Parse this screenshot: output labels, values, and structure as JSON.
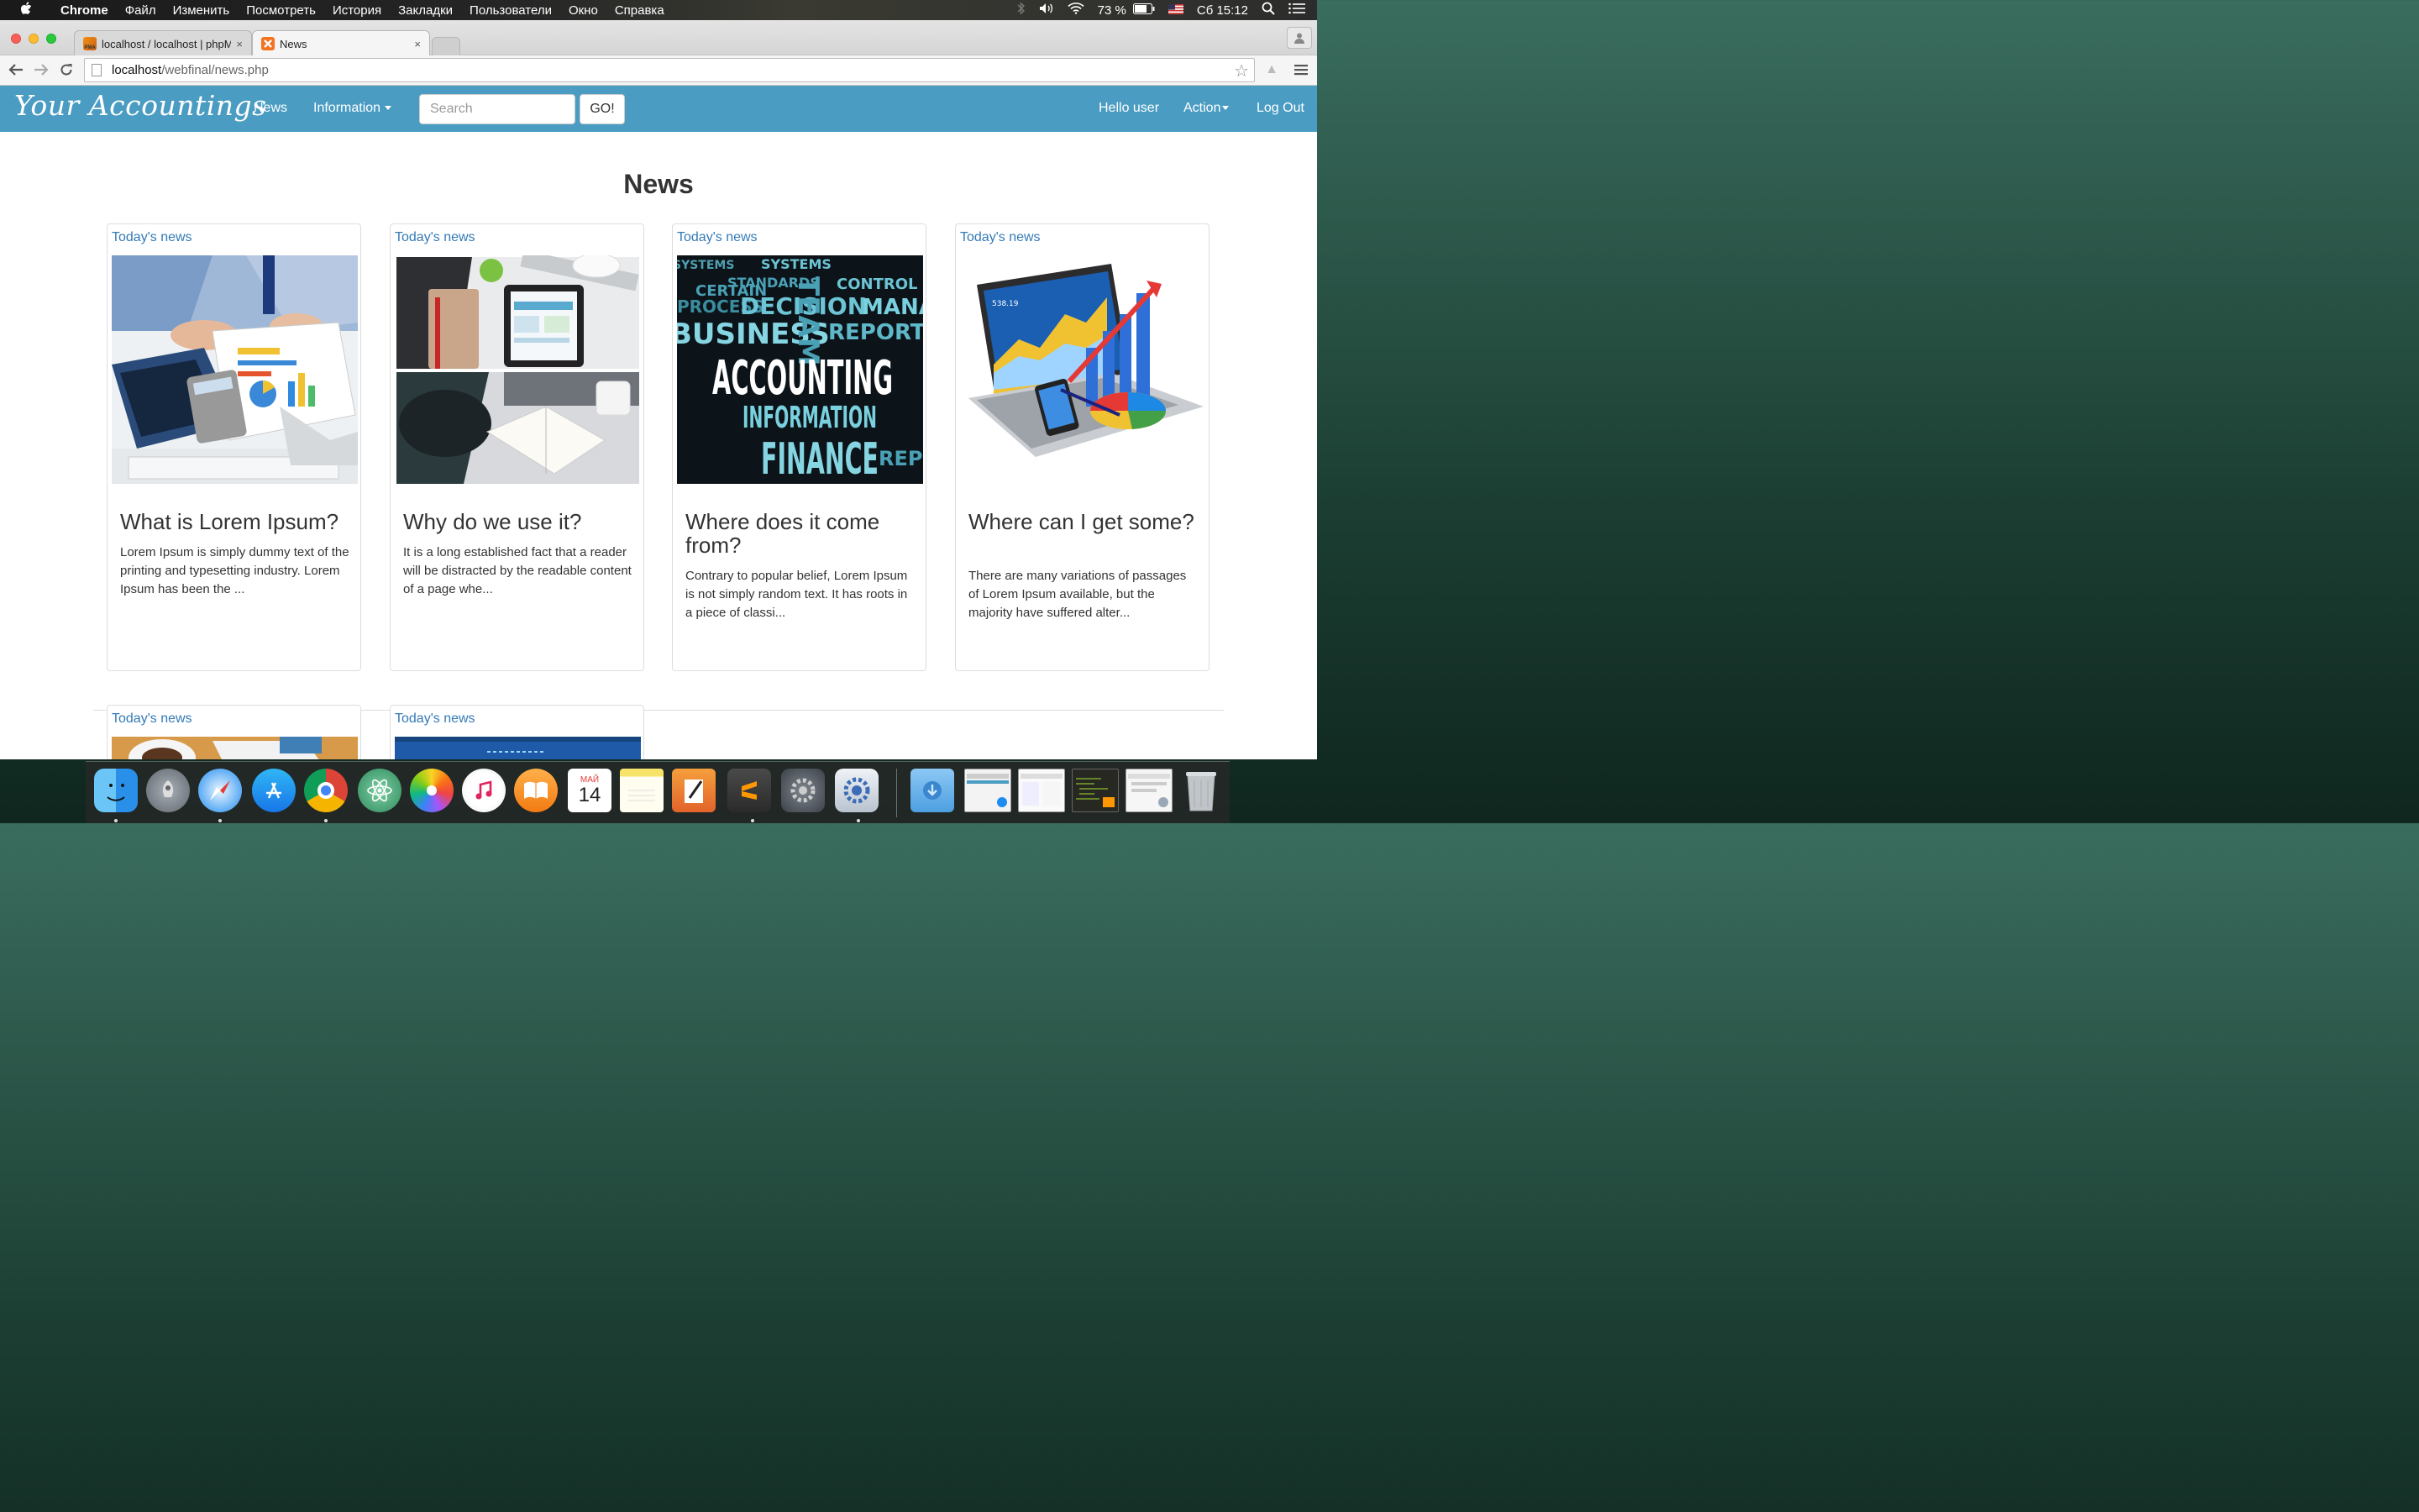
{
  "menubar": {
    "app": "Chrome",
    "items": [
      "Файл",
      "Изменить",
      "Посмотреть",
      "История",
      "Закладки",
      "Пользователи",
      "Окно",
      "Справка"
    ],
    "battery": "73 %",
    "clock": "Сб 15:12"
  },
  "browser": {
    "tabs": [
      {
        "label": "localhost / localhost | phpMyAdmin",
        "favicon_text": "PMA",
        "close": "×"
      },
      {
        "label": "News",
        "close": "×"
      }
    ],
    "url_host": "localhost",
    "url_path": "/webfinal/news.php"
  },
  "navbar": {
    "brand": "Your Accountings",
    "news": "News",
    "information": "Information",
    "search_placeholder": "Search",
    "go": "GO!",
    "hello": "Hello user",
    "action": "Action",
    "logout": "Log Out"
  },
  "page": {
    "heading": "News",
    "cards": [
      {
        "category": "Today's news",
        "title": "What is Lorem Ipsum?",
        "text": "Lorem Ipsum is simply dummy text of the printing and typesetting industry. Lorem Ipsum has been the ...",
        "image": "accountants-desk-photo"
      },
      {
        "category": "Today's news",
        "title": "Why do we use it?",
        "text": "It is a long established fact that a reader will be distracted by the readable content of a page whe...",
        "image": "tablet-and-notebook-photo"
      },
      {
        "category": "Today's news",
        "title": "Where does it come from?",
        "text": "Contrary to popular belief, Lorem Ipsum is not simply random text. It has roots in a piece of classi...",
        "image": "accounting-word-cloud"
      },
      {
        "category": "Today's news",
        "title": "Where can I get some?",
        "text": "There are many variations of passages of Lorem Ipsum available, but the majority have suffered alter...",
        "image": "laptop-with-charts"
      },
      {
        "category": "Today's news",
        "image": "coffee-and-papers-photo"
      },
      {
        "category": "Today's news",
        "image": "blue-banner-photo"
      }
    ],
    "wordcloud": {
      "main": "ACCOUNTING",
      "words": [
        "BUSINESS",
        "DECISION",
        "TEAM",
        "INFORMATION",
        "FINANCE",
        "STANDARDS",
        "MANAGER",
        "PROCESS",
        "CERTAIN",
        "REPORTING",
        "SYSTEMS",
        "CONTROL"
      ]
    },
    "laptop_readout": "538.19"
  },
  "dock": {
    "calendar_month": "МАЙ",
    "calendar_day": "14",
    "apps": [
      "finder",
      "launchpad",
      "safari",
      "app-store",
      "chrome",
      "atom",
      "photos",
      "itunes",
      "ibooks",
      "calendar",
      "notes",
      "pages",
      "sublime-text",
      "system-preferences",
      "preferences-gear",
      "downloads-folder",
      "window-thumb-1",
      "window-thumb-2",
      "window-thumb-3",
      "window-thumb-4",
      "trash"
    ]
  },
  "colors": {
    "navbar": "#4a9cc2",
    "link": "#337ab7",
    "text": "#333333"
  }
}
